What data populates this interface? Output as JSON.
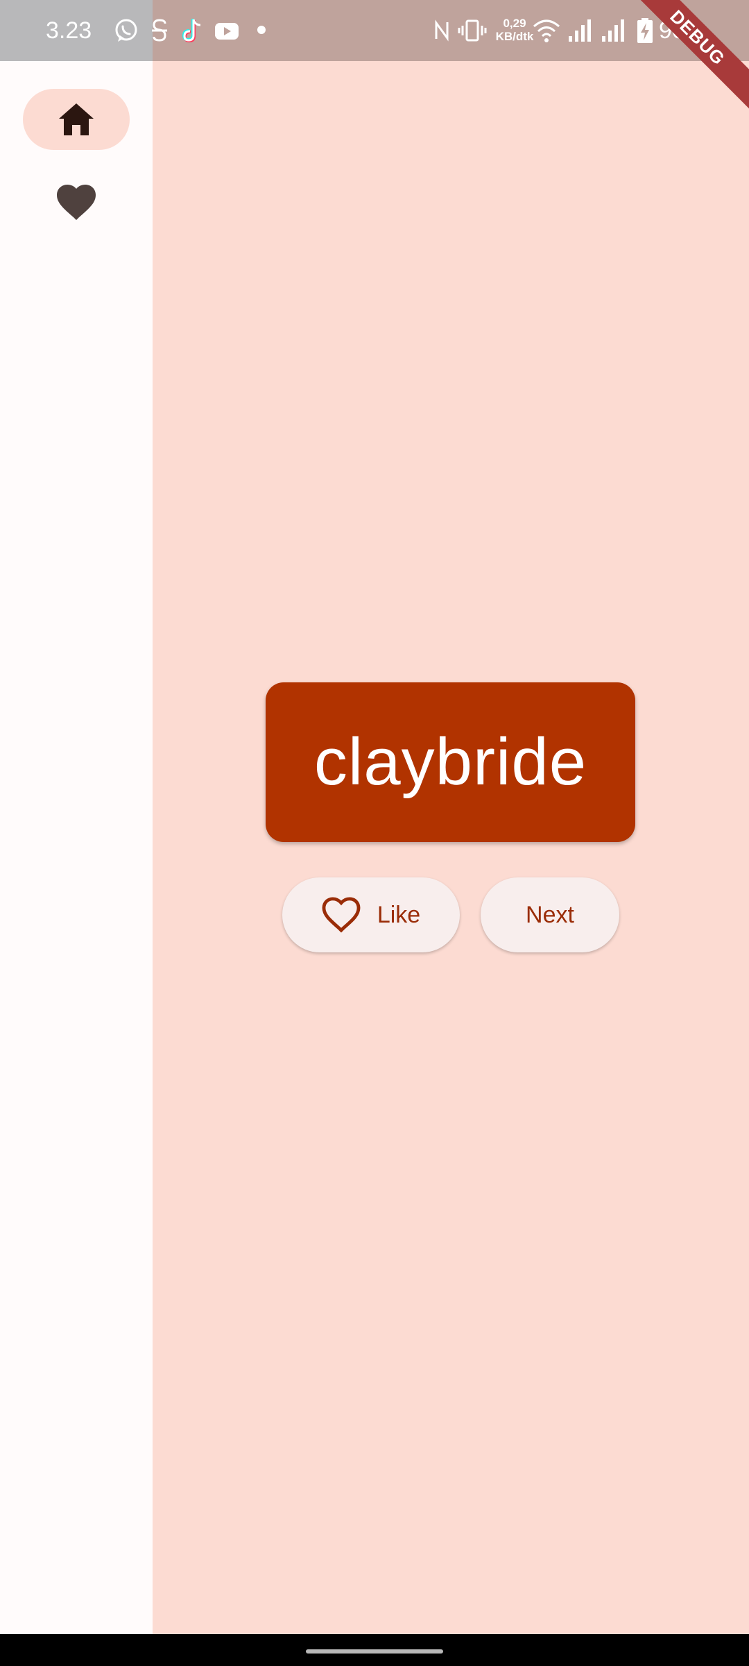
{
  "status_bar": {
    "time": "3.23",
    "net_speed_value": "0,29",
    "net_speed_unit": "KB/dtk",
    "battery_percent": "90%",
    "notification_icons": [
      "whatsapp-icon",
      "s-app-icon",
      "tiktok-icon",
      "youtube-icon",
      "dot-icon"
    ],
    "system_icons": [
      "nfc-icon",
      "vibrate-icon",
      "wifi-icon",
      "signal-icon",
      "signal-icon",
      "battery-charging-icon"
    ]
  },
  "debug_banner": "DEBUG",
  "nav_rail": {
    "destinations": [
      {
        "icon": "home-icon",
        "selected": true
      },
      {
        "icon": "heart-icon",
        "selected": false
      }
    ]
  },
  "main": {
    "word": "claybride",
    "like_label": "Like",
    "next_label": "Next"
  },
  "colors": {
    "background": "#fcdbd2",
    "rail_background": "#fffbfb",
    "card": "#b13300",
    "button_text": "#9a2c07",
    "button_background": "#f8eeed"
  }
}
